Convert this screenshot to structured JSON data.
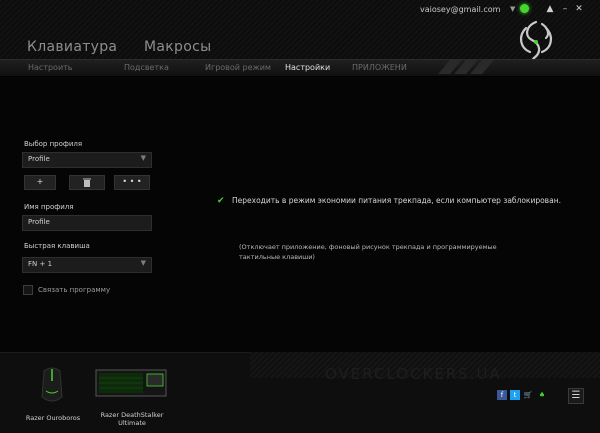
{
  "window": {
    "email": "vaiosey@gmail.com"
  },
  "main_tabs": [
    {
      "label": "Клавиатура"
    },
    {
      "label": "Макросы"
    }
  ],
  "sub_tabs": [
    {
      "label": "Настроить"
    },
    {
      "label": "Подсветка"
    },
    {
      "label": "Игровой режим"
    },
    {
      "label": "Настройки",
      "active": true
    },
    {
      "label": "ПРИЛОЖЕНИ"
    }
  ],
  "profile": {
    "select_label": "Выбор профиля",
    "select_value": "Profile",
    "add_label": "+",
    "more_label": "• • •",
    "name_label": "Имя профиля",
    "name_value": "Profile",
    "hotkey_label": "Быстрая клавиша",
    "hotkey_value": "FN + 1",
    "link_program_label": "Связать программу"
  },
  "settings": {
    "power_saving_checked": true,
    "power_saving_text": "Переходить в режим экономии питания трекпада, если компьютер заблокирован.",
    "power_saving_note": "(Отключает приложение, фоновый рисунок трекпада и программируемые тактильные клавиши)"
  },
  "footer": {
    "watermark": "OVERCLOCKERS.UA",
    "devices": [
      {
        "name": "Razer Ouroboros"
      },
      {
        "name": "Razer DeathStalker Ultimate"
      }
    ],
    "menu_label": "☰"
  },
  "colors": {
    "accent": "#44d62c",
    "background": "#050505"
  },
  "icons": {
    "facebook": "facebook-icon",
    "twitter": "twitter-icon",
    "cart": "cart-icon",
    "razer": "razer-logo-icon"
  }
}
